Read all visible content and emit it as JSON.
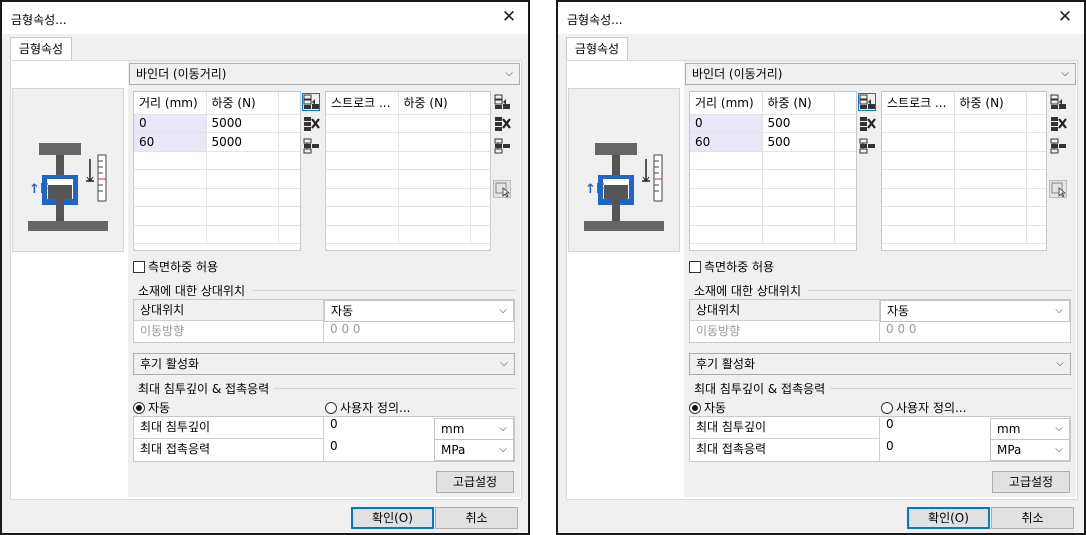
{
  "dialogs": [
    {
      "title": "금형속성...",
      "tab": "금형속성",
      "mode_select": "바인더 (이동거리)",
      "table1": {
        "headers": [
          "거리 (mm)",
          "하중 (N)"
        ],
        "rows": [
          [
            "0",
            "5000"
          ],
          [
            "60",
            "5000"
          ]
        ]
      },
      "table2": {
        "headers": [
          "스트로크 ...",
          "하중 (N)"
        ]
      },
      "side_load_label": "측면하중 허용",
      "relative_section": "소재에 대한 상대위치",
      "relative_label": "상대위치",
      "relative_value": "자동",
      "move_dir_label": "이동방향",
      "move_dir_value": "0 0 0",
      "post_activation": "후기 활성화",
      "penetration_section": "최대 침투깊이 & 접촉응력",
      "radio_auto": "자동",
      "radio_user": "사용자 정의...",
      "max_depth_label": "최대 침투깊이",
      "max_depth_value": "0",
      "max_depth_unit": "mm",
      "max_stress_label": "최대 접촉응력",
      "max_stress_value": "0",
      "max_stress_unit": "MPa",
      "advanced_button": "고급설정",
      "ok_button": "확인(O)",
      "cancel_button": "취소"
    },
    {
      "title": "금형속성...",
      "tab": "금형속성",
      "mode_select": "바인더 (이동거리)",
      "table1": {
        "headers": [
          "거리 (mm)",
          "하중 (N)"
        ],
        "rows": [
          [
            "0",
            "500"
          ],
          [
            "60",
            "500"
          ]
        ]
      },
      "table2": {
        "headers": [
          "스트로크 ...",
          "하중 (N)"
        ]
      },
      "side_load_label": "측면하중 허용",
      "relative_section": "소재에 대한 상대위치",
      "relative_label": "상대위치",
      "relative_value": "자동",
      "move_dir_label": "이동방향",
      "move_dir_value": "0 0 0",
      "post_activation": "후기 활성화",
      "penetration_section": "최대 침투깊이 & 접촉응력",
      "radio_auto": "자동",
      "radio_user": "사용자 정의...",
      "max_depth_label": "최대 침투깊이",
      "max_depth_value": "0",
      "max_depth_unit": "mm",
      "max_stress_label": "최대 접촉응력",
      "max_stress_value": "0",
      "max_stress_unit": "MPa",
      "advanced_button": "고급설정",
      "ok_button": "확인(O)",
      "cancel_button": "취소"
    }
  ]
}
